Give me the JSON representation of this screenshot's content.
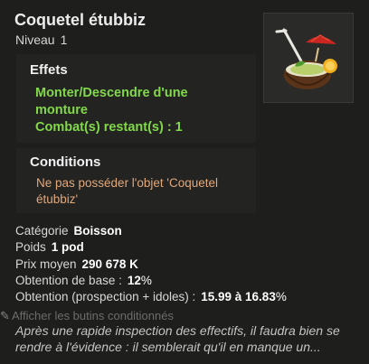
{
  "item": {
    "name": "Coquetel étubbiz",
    "level_label": "Niveau",
    "level_value": "1"
  },
  "effects": {
    "title": "Effets",
    "items": [
      "Monter/Descendre d'une monture",
      "Combat(s) restant(s) : 1"
    ]
  },
  "conditions": {
    "title": "Conditions",
    "items": [
      "Ne pas posséder l'objet 'Coquetel étubbiz'"
    ]
  },
  "stats": {
    "category_label": "Catégorie",
    "category_value": "Boisson",
    "weight_label": "Poids",
    "weight_value": "1 pod",
    "price_label": "Prix moyen",
    "price_value": "290 678 K",
    "base_drop_label": "Obtention de base :",
    "base_drop_value": "12",
    "base_drop_unit": "%",
    "prosp_drop_label": "Obtention (prospection + idoles) :",
    "prosp_drop_value": "15.99 à 16.83",
    "prosp_drop_unit": "%"
  },
  "toggle_label": "Afficher les butins conditionnés",
  "description": "Après une rapide inspection des effectifs, il faudra bien se rendre à l'évidence : il semblerait qu'il en manque un...",
  "colors": {
    "effect_green": "#82d84a",
    "condition_orange": "#e3a87a"
  },
  "icon": "coconut-cocktail-icon"
}
